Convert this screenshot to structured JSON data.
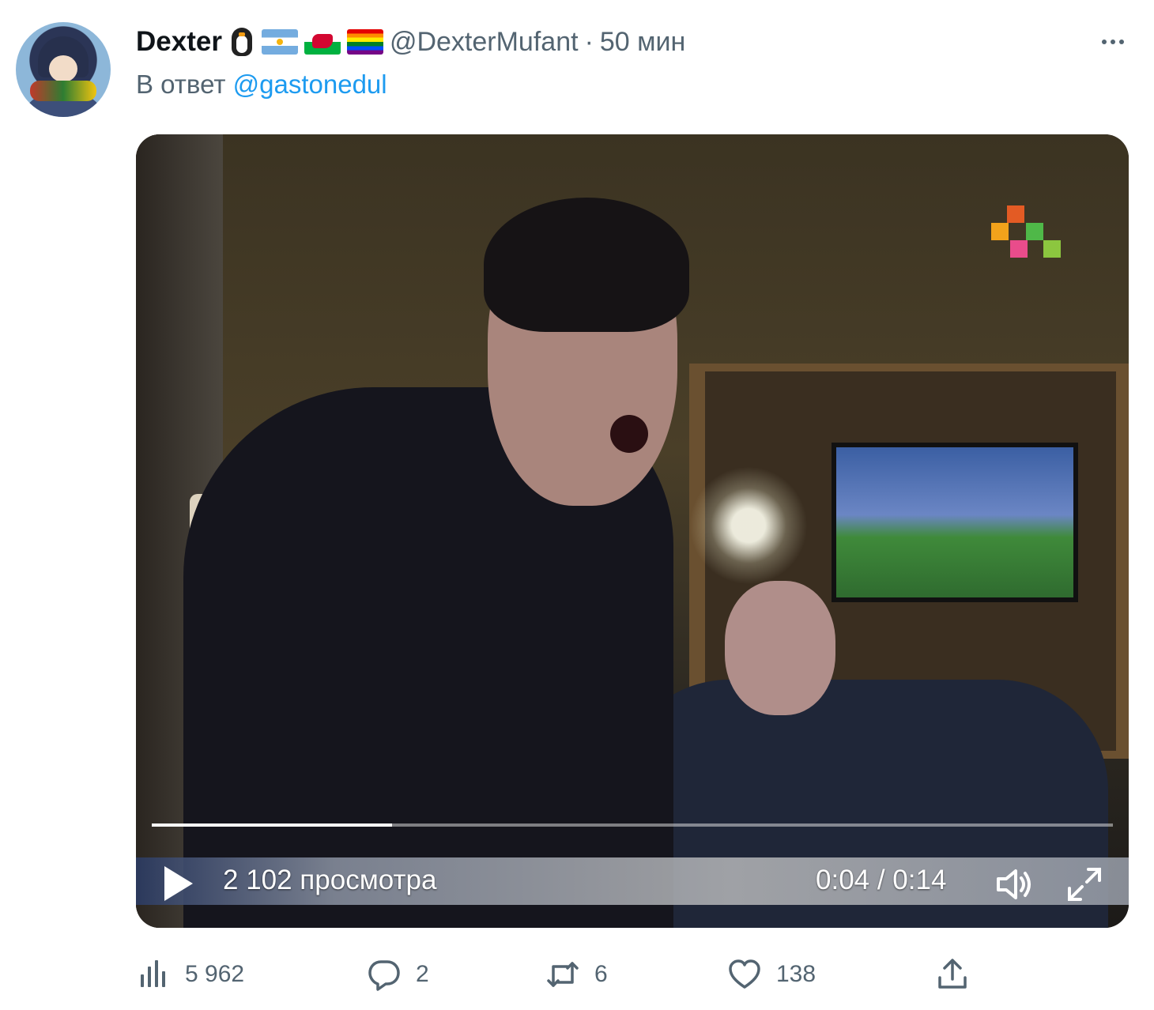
{
  "tweet": {
    "display_name": "Dexter",
    "handle": "@DexterMufant",
    "separator": "·",
    "time": "50 мин",
    "reply_prefix": "В ответ",
    "reply_to": "@gastonedul"
  },
  "emojis": [
    "penguin-icon",
    "flag-argentina-icon",
    "flag-wales-icon",
    "flag-rainbow-icon"
  ],
  "video": {
    "views": "2 102 просмотра",
    "time": "0:04 / 0:14",
    "progress": 0.25
  },
  "actions": {
    "views_count": "5 962",
    "replies": "2",
    "retweets": "6",
    "likes": "138"
  },
  "colors": {
    "accent": "#1d9bf0",
    "muted": "#536471"
  }
}
